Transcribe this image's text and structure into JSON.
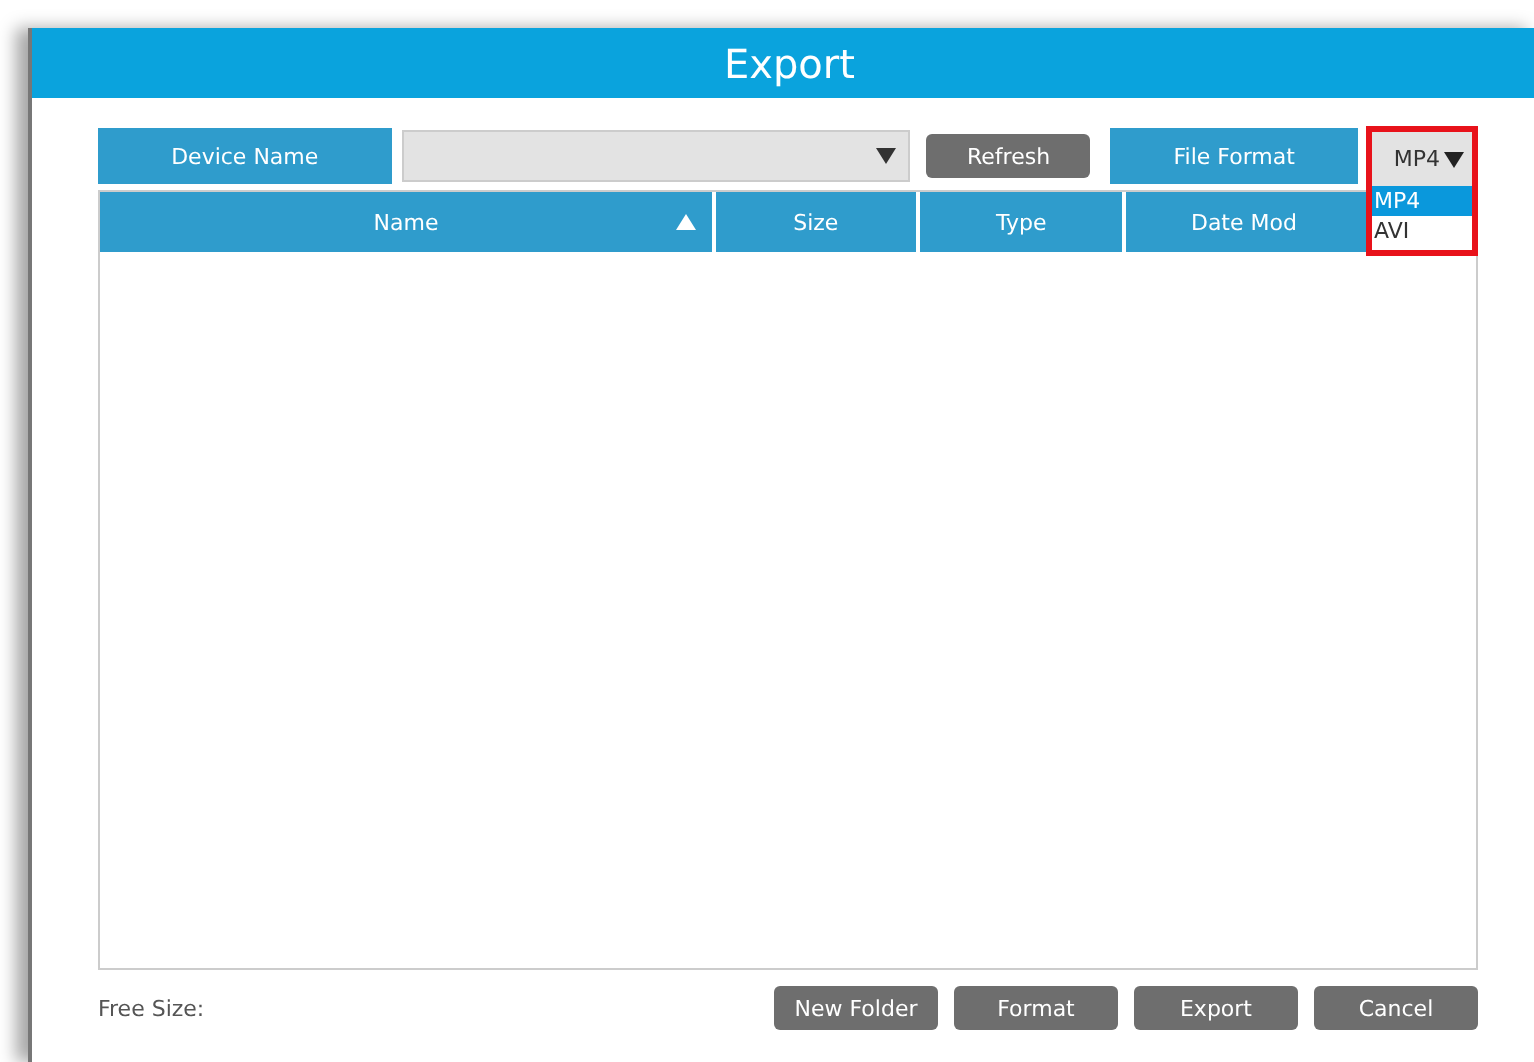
{
  "window": {
    "title": "Export"
  },
  "toolbar": {
    "device_label": "Device Name",
    "refresh": "Refresh",
    "format_label": "File Format",
    "format_value": "MP4",
    "format_highlighted": true,
    "format_options": [
      {
        "label": "MP4",
        "selected": true
      },
      {
        "label": "AVI",
        "selected": false
      }
    ]
  },
  "table": {
    "columns": [
      {
        "label": "Name",
        "sorted": true
      },
      {
        "label": "Size",
        "sorted": false
      },
      {
        "label": "Type",
        "sorted": false
      },
      {
        "label": "Date Mod"
      }
    ]
  },
  "footer": {
    "free_size": "Free Size:",
    "buttons": [
      "New Folder",
      "Format",
      "Export",
      "Cancel"
    ]
  }
}
